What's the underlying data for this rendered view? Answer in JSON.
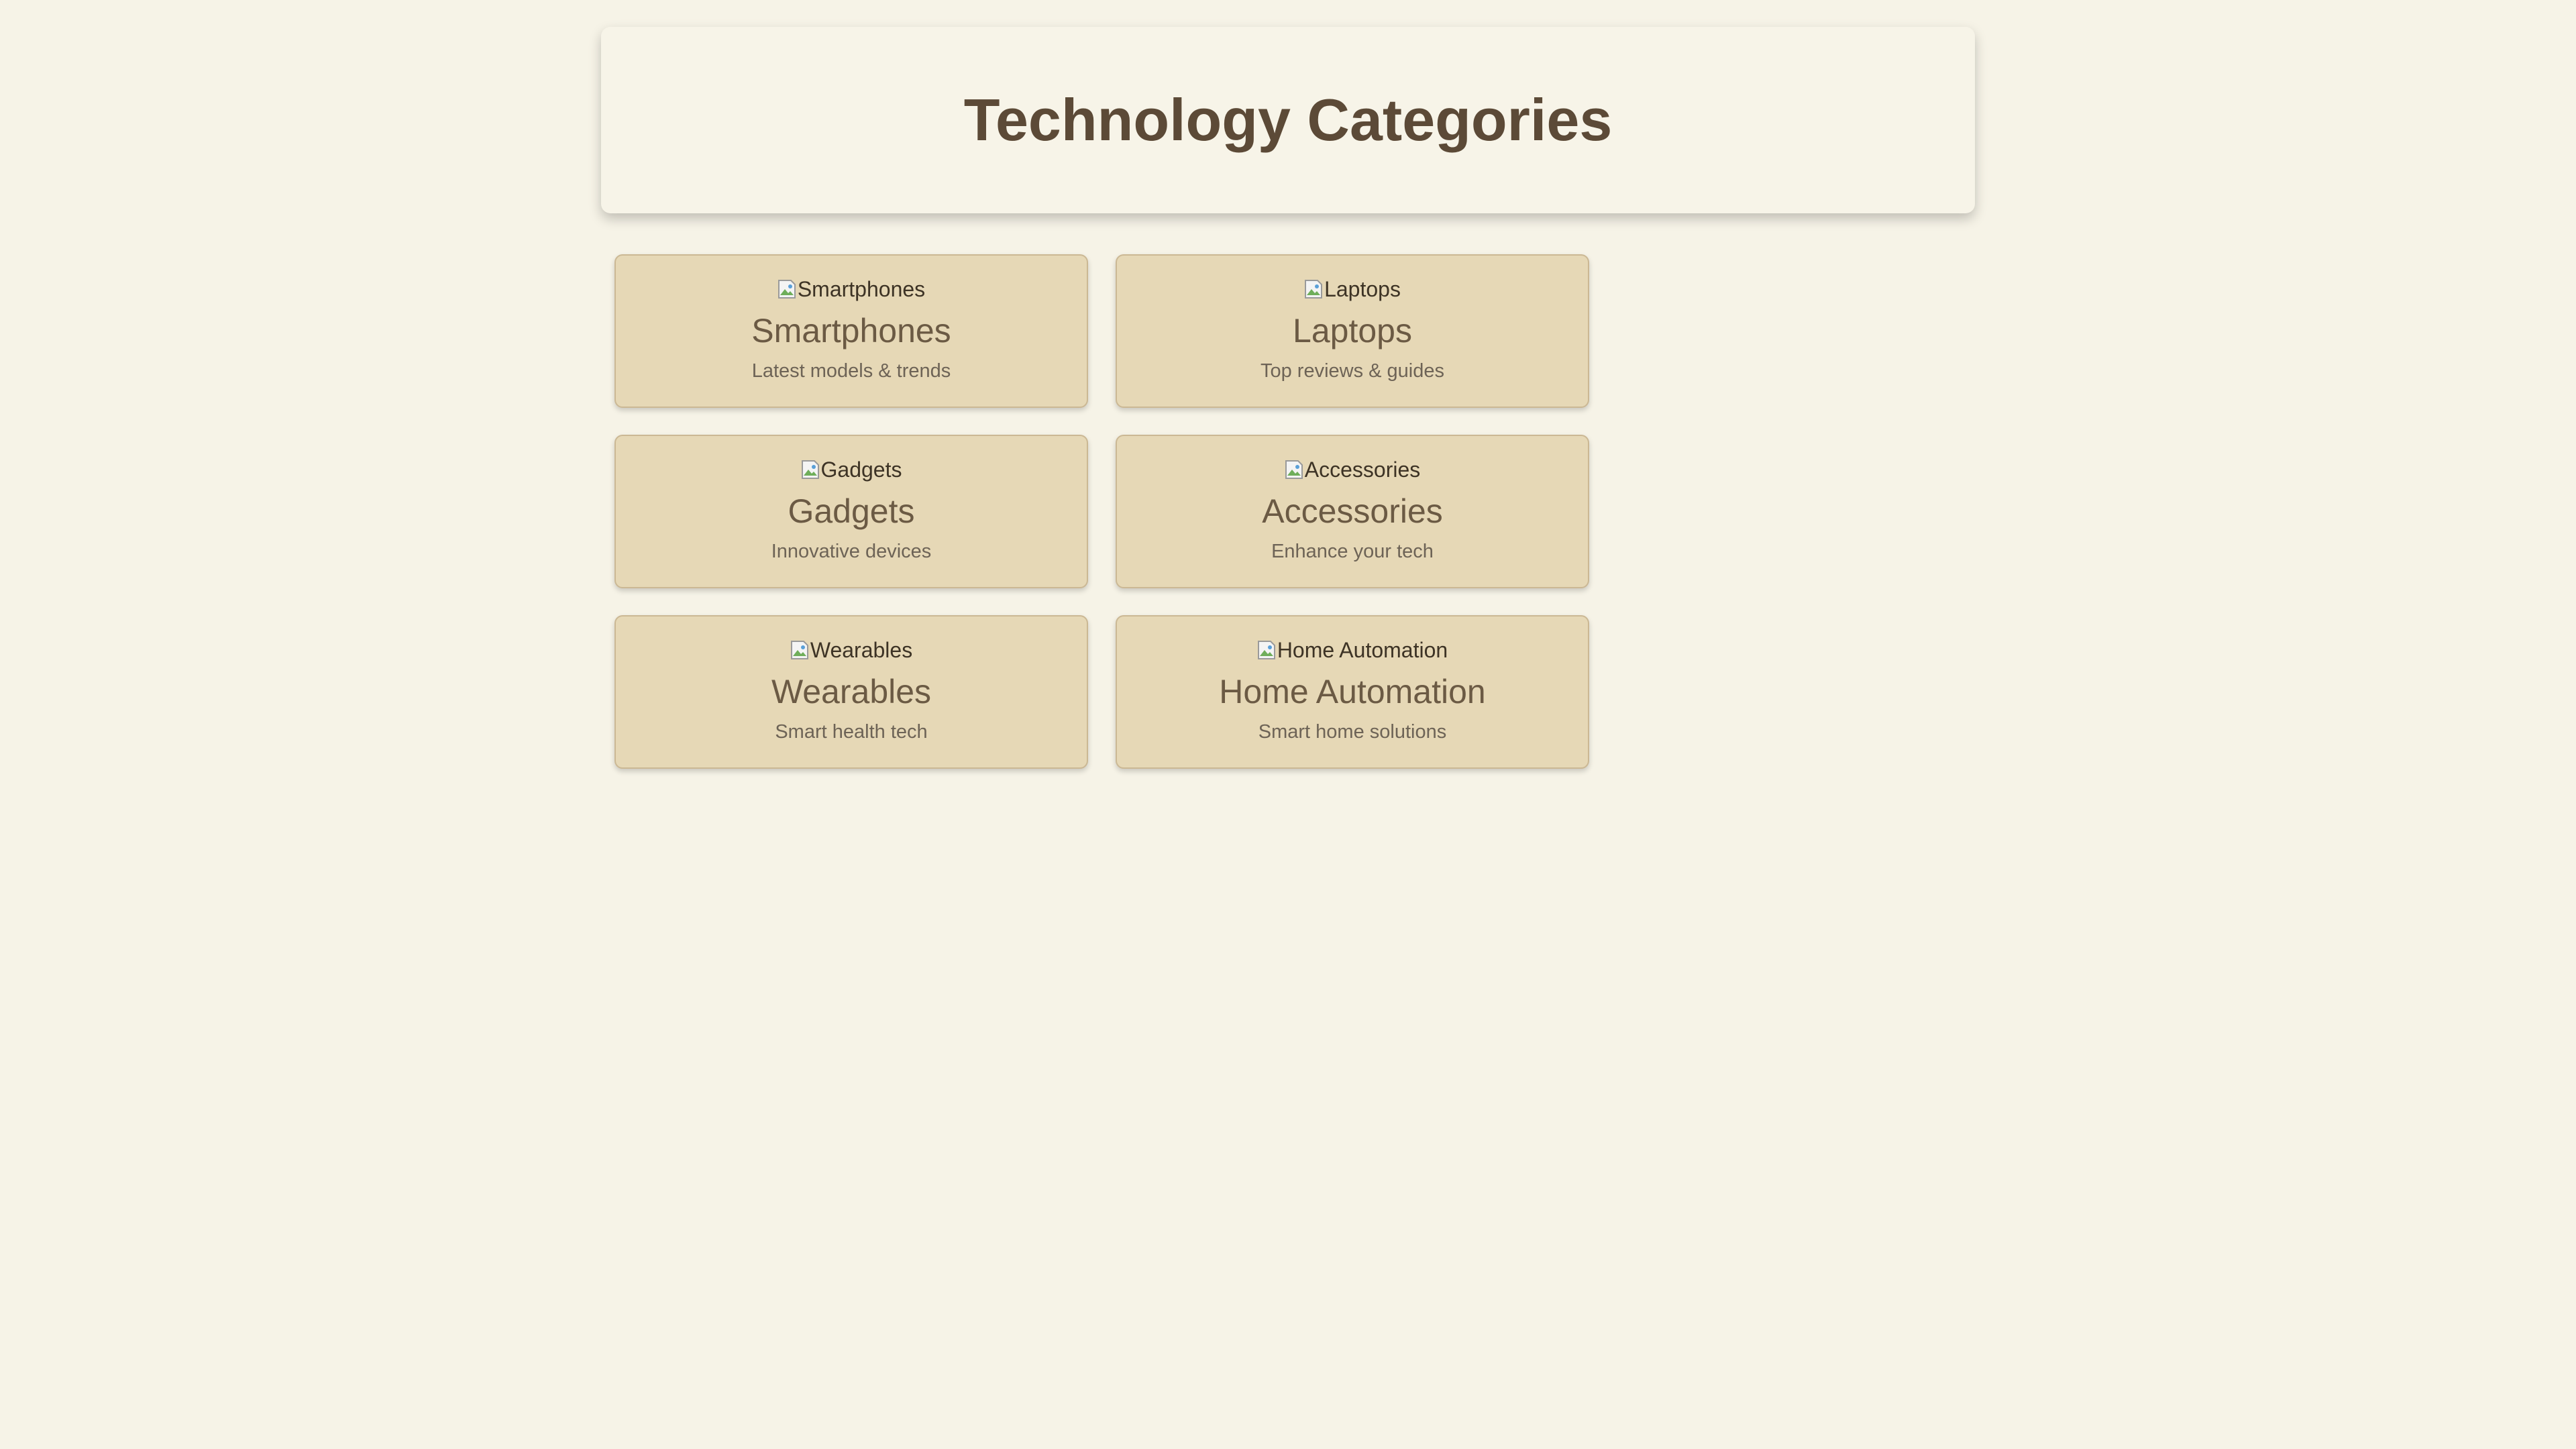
{
  "page": {
    "title": "Technology Categories"
  },
  "categories": [
    {
      "image_alt": "Smartphones",
      "title": "Smartphones",
      "description": "Latest models & trends"
    },
    {
      "image_alt": "Laptops",
      "title": "Laptops",
      "description": "Top reviews & guides"
    },
    {
      "image_alt": "Gadgets",
      "title": "Gadgets",
      "description": "Innovative devices"
    },
    {
      "image_alt": "Accessories",
      "title": "Accessories",
      "description": "Enhance your tech"
    },
    {
      "image_alt": "Wearables",
      "title": "Wearables",
      "description": "Smart health tech"
    },
    {
      "image_alt": "Home Automation",
      "title": "Home Automation",
      "description": "Smart home solutions"
    }
  ],
  "colors": {
    "background": "#f6f3e7",
    "header_background": "#f7f4e8",
    "title_text": "#5c4a37",
    "card_background": "#e6d8b6",
    "card_border": "#cbb894",
    "card_title": "#6b5a44",
    "card_description": "#6d6356"
  },
  "icons": {
    "card_image": "broken-image-icon"
  }
}
